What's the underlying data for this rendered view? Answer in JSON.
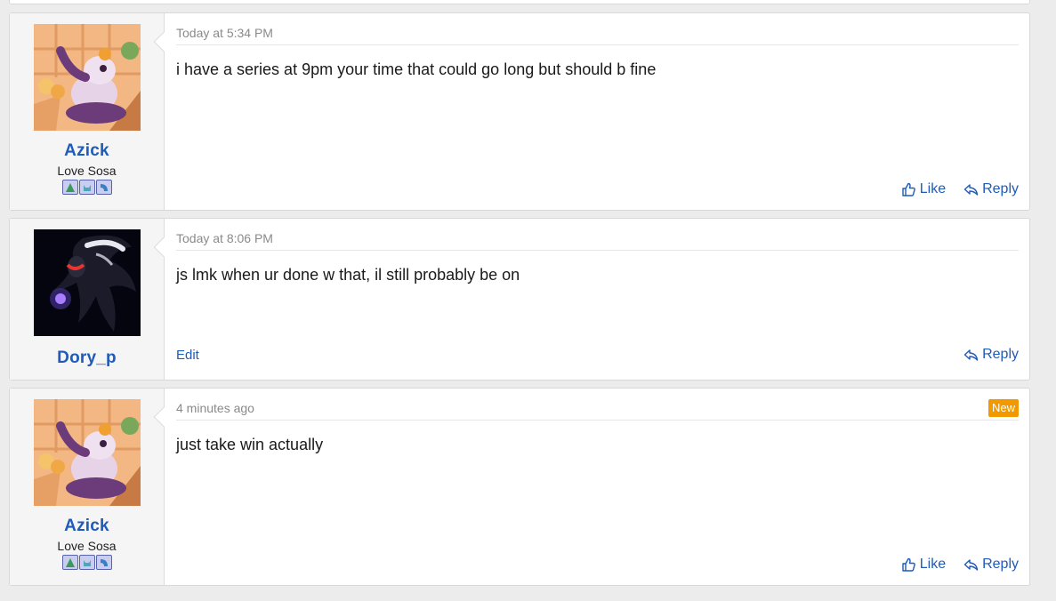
{
  "posts": [
    {
      "username": "Azick",
      "user_title": "Love Sosa",
      "timestamp": "Today at 5:34 PM",
      "message": "i have a series at 9pm your time that could go long but should b fine",
      "like_label": "Like",
      "reply_label": "Reply",
      "banners": [
        "leaf-badge-icon",
        "cat-badge-icon",
        "wave-badge-icon"
      ]
    },
    {
      "username": "Dory_p",
      "timestamp": "Today at 8:06 PM",
      "message": "js lmk when ur done w that, il still probably be on",
      "edit_label": "Edit",
      "reply_label": "Reply"
    },
    {
      "username": "Azick",
      "user_title": "Love Sosa",
      "timestamp": "4 minutes ago",
      "badge": "New",
      "message": "just take win actually",
      "like_label": "Like",
      "reply_label": "Reply",
      "banners": [
        "leaf-badge-icon",
        "cat-badge-icon",
        "wave-badge-icon"
      ]
    }
  ],
  "colors": {
    "link": "#1f5bb8",
    "new_badge": "#f29900",
    "page_bg": "#ececec"
  }
}
